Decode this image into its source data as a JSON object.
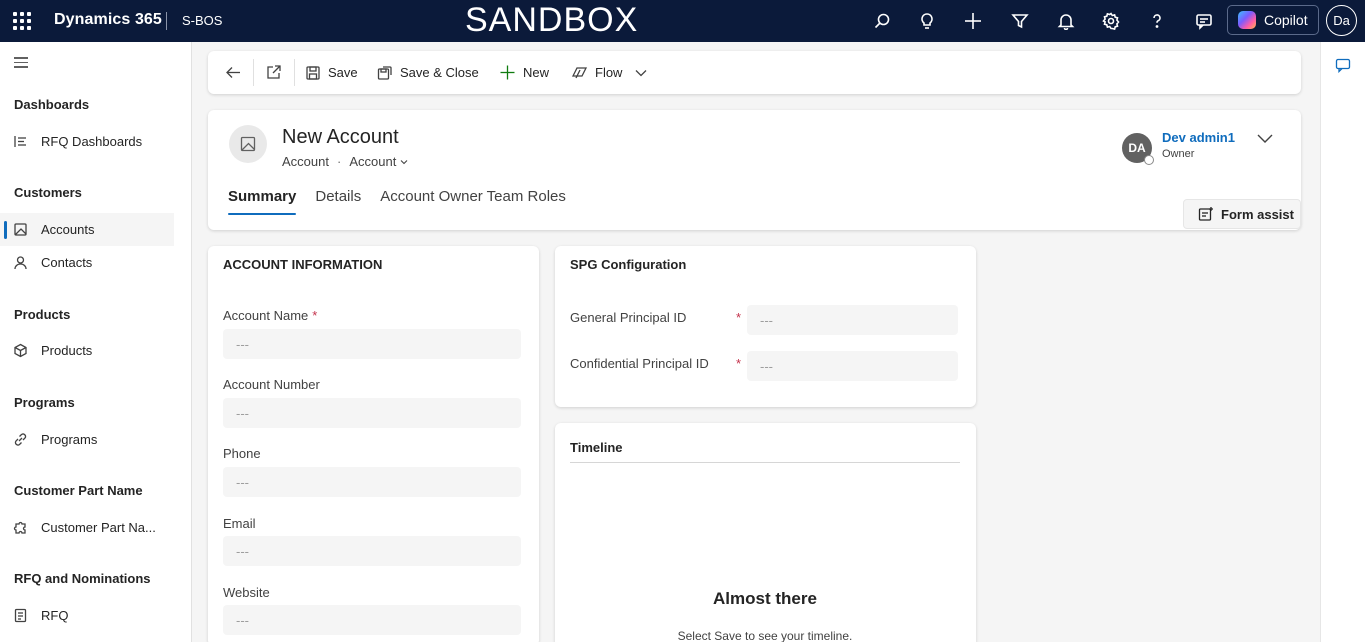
{
  "topbar": {
    "brand": "Dynamics 365",
    "app_name": "S-BOS",
    "environment_label": "SANDBOX",
    "icons": [
      "search-icon",
      "lightbulb-icon",
      "plus-icon",
      "filter-icon",
      "bell-icon",
      "gear-icon",
      "help-icon",
      "chat-icon"
    ],
    "copilot_label": "Copilot",
    "user_initials": "Da"
  },
  "sidenav": {
    "groups": [
      {
        "label": "Dashboards",
        "items": [
          {
            "label": "RFQ Dashboards",
            "icon": "dashboard-icon"
          }
        ]
      },
      {
        "label": "Customers",
        "items": [
          {
            "label": "Accounts",
            "icon": "account-icon",
            "active": true
          },
          {
            "label": "Contacts",
            "icon": "person-icon"
          }
        ]
      },
      {
        "label": "Products",
        "items": [
          {
            "label": "Products",
            "icon": "cube-icon"
          }
        ]
      },
      {
        "label": "Programs",
        "items": [
          {
            "label": "Programs",
            "icon": "link-icon"
          }
        ]
      },
      {
        "label": "Customer Part Name",
        "items": [
          {
            "label": "Customer Part Na...",
            "icon": "puzzle-icon"
          }
        ]
      },
      {
        "label": "RFQ and Nominations",
        "items": [
          {
            "label": "RFQ",
            "icon": "document-icon"
          }
        ]
      }
    ]
  },
  "commandbar": {
    "save_label": "Save",
    "save_close_label": "Save & Close",
    "new_label": "New",
    "flow_label": "Flow"
  },
  "record": {
    "title": "New Account",
    "entity_type": "Account",
    "form_selector": "Account",
    "owner_initials": "DA",
    "owner_name": "Dev admin1",
    "owner_role": "Owner",
    "tabs": [
      "Summary",
      "Details",
      "Account Owner Team Roles"
    ],
    "active_tab": "Summary",
    "form_assist_label": "Form assist"
  },
  "account_information": {
    "title": "ACCOUNT INFORMATION",
    "fields": [
      {
        "label": "Account Name",
        "required": true,
        "value": "---"
      },
      {
        "label": "Account Number",
        "required": false,
        "value": "---"
      },
      {
        "label": "Phone",
        "required": false,
        "value": "---"
      },
      {
        "label": "Email",
        "required": false,
        "value": "---"
      },
      {
        "label": "Website",
        "required": false,
        "value": "---"
      }
    ]
  },
  "spg_configuration": {
    "title": "SPG Configuration",
    "fields": [
      {
        "label": "General Principal ID",
        "required": true,
        "value": "---"
      },
      {
        "label": "Confidential Principal ID",
        "required": true,
        "value": "---"
      }
    ]
  },
  "timeline": {
    "title": "Timeline",
    "empty_title": "Almost there",
    "empty_subtitle": "Select Save to see your timeline."
  },
  "colors": {
    "topbar_bg": "#0b1a3a",
    "accent": "#0f6cbd",
    "required": "#c4314b"
  }
}
